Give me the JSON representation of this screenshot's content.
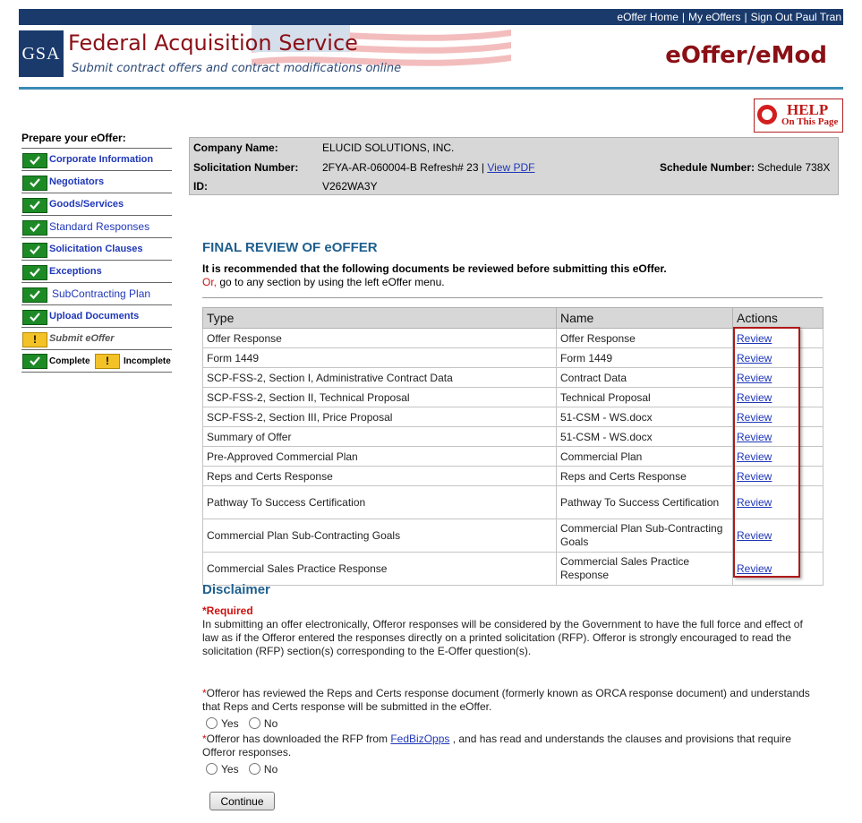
{
  "topnav": {
    "home": "eOffer Home",
    "my_eoffers": "My eOffers",
    "signout": "Sign Out Paul Tran",
    "sep": "|"
  },
  "header": {
    "logo": "GSA",
    "agency": "Federal Acquisition Service",
    "tagline": "Submit contract offers and contract modifications online",
    "app_title": "eOffer/eMod"
  },
  "help": {
    "line1": "HELP",
    "line2": "On This Page"
  },
  "nav": {
    "title": "Prepare your eOffer:",
    "items": [
      {
        "label": "Corporate Information",
        "status": "complete"
      },
      {
        "label": "Negotiators",
        "status": "complete"
      },
      {
        "label": "Goods/Services",
        "status": "complete"
      },
      {
        "label": "Standard Responses",
        "status": "complete"
      },
      {
        "label": "Solicitation Clauses",
        "status": "complete"
      },
      {
        "label": "Exceptions",
        "status": "complete"
      },
      {
        "label": "SubContracting Plan",
        "status": "complete"
      },
      {
        "label": "Upload Documents",
        "status": "complete"
      },
      {
        "label": "Submit eOffer",
        "status": "incomplete"
      }
    ],
    "legend": {
      "complete": "Complete",
      "incomplete": "Incomplete",
      "warn_glyph": "!"
    }
  },
  "info": {
    "company_label": "Company Name:",
    "company_value": "ELUCID SOLUTIONS, INC.",
    "solicitation_label": "Solicitation Number:",
    "solicitation_value": "2FYA-AR-060004-B Refresh# 23 |",
    "view_pdf": "View PDF",
    "schedule_label": "Schedule Number:",
    "schedule_value": "Schedule 738X",
    "id_label": "ID:",
    "id_value": "V262WA3Y"
  },
  "review": {
    "title": "FINAL REVIEW OF eOFFER",
    "intro_bold": "It is recommended that the following documents be reviewed before submitting this eOffer.",
    "intro_or": "Or,",
    "intro_rest": " go to any section by using the left eOffer menu.",
    "columns": [
      "Type",
      "Name",
      "Actions"
    ],
    "rows": [
      {
        "type": "Offer Response",
        "name": "Offer Response",
        "action": "Review"
      },
      {
        "type": "Form 1449",
        "name": "Form 1449",
        "action": "Review"
      },
      {
        "type": "SCP-FSS-2, Section I, Administrative Contract Data",
        "name": "Contract Data",
        "action": "Review"
      },
      {
        "type": "SCP-FSS-2, Section II, Technical Proposal",
        "name": "Technical Proposal",
        "action": "Review"
      },
      {
        "type": "SCP-FSS-2, Section III, Price Proposal",
        "name": "51-CSM - WS.docx",
        "action": "Review"
      },
      {
        "type": "Summary of Offer",
        "name": "51-CSM - WS.docx",
        "action": "Review"
      },
      {
        "type": "Pre-Approved Commercial Plan",
        "name": "Commercial Plan",
        "action": "Review"
      },
      {
        "type": "Reps and Certs Response",
        "name": "Reps and Certs Response",
        "action": "Review"
      },
      {
        "type": "Pathway To Success Certification",
        "name": "Pathway To Success Certification",
        "action": "Review"
      },
      {
        "type": "Commercial Plan Sub-Contracting Goals",
        "name": "Commercial Plan Sub-Contracting Goals",
        "action": "Review"
      },
      {
        "type": "Commercial Sales Practice Response",
        "name": "Commercial Sales Practice Response",
        "action": "Review"
      }
    ]
  },
  "disclaimer": {
    "title": "Disclaimer",
    "required": "*Required",
    "text": "In submitting an offer electronically, Offeror responses will be considered by the Government to have the full force and effect of law as if the Offeror entered the responses directly on a printed solicitation (RFP). Offeror is strongly encouraged to read the solicitation (RFP) section(s) corresponding to the E-Offer question(s).",
    "q1_star": "*",
    "q1": "Offeror has reviewed the Reps and Certs response document (formerly known as ORCA response document) and understands that Reps and Certs response will be submitted in the eOffer.",
    "q2_star": "*",
    "q2_pre": "Offeror has downloaded the RFP from ",
    "q2_link": "FedBizOpps",
    "q2_post": " , and has read and understands the clauses and provisions that require Offeror responses.",
    "yes": "Yes",
    "no": "No"
  },
  "continue_label": "Continue"
}
